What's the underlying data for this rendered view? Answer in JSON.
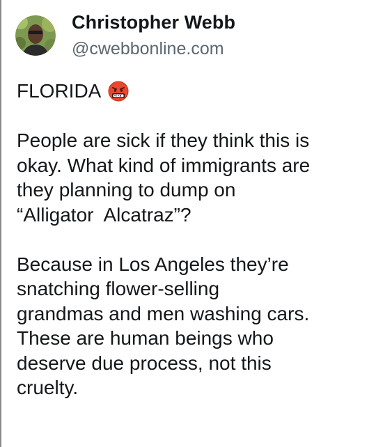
{
  "author": {
    "display_name": "Christopher Webb",
    "handle": "@cwebbonline.com",
    "avatar_icon": "avatar-photo"
  },
  "post": {
    "headline": "FLORIDA",
    "headline_emoji": "face-with-symbols-on-mouth",
    "paragraph_1_lines": [
      "People are sick if they think this is",
      "okay. What kind of immigrants are",
      "they planning to dump on",
      "“Alligator  Alcatraz”?"
    ],
    "paragraph_2_lines": [
      "Because in Los Angeles they’re",
      "snatching flower-selling",
      "grandmas and men washing cars.",
      "These are human beings who",
      "deserve due process, not this",
      "cruelty."
    ]
  },
  "colors": {
    "text": "#14171a",
    "secondary_text": "#5b6770",
    "background": "#ffffff",
    "emoji_face": "#e8472e"
  }
}
